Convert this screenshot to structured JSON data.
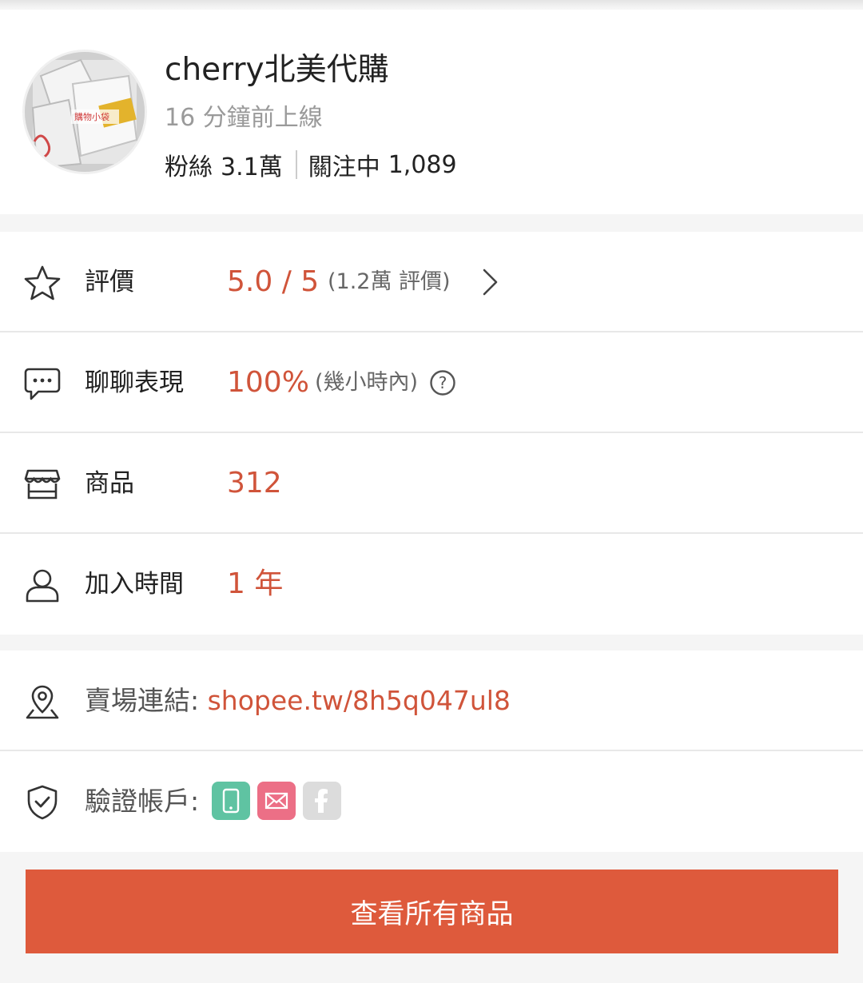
{
  "profile": {
    "shop_name": "cherry北美代購",
    "last_online": "16 分鐘前上線",
    "followers_label": "粉絲",
    "followers_value": "3.1萬",
    "following_label": "關注中",
    "following_value": "1,089",
    "avatar_text": "購物小袋"
  },
  "rows": {
    "rating": {
      "label": "評價",
      "value": "5.0 / 5",
      "note": "(1.2萬 評價)",
      "icon": "star-icon"
    },
    "chat": {
      "label": "聊聊表現",
      "value": "100%",
      "note": "(幾小時內)",
      "icon": "chat-bubble-icon"
    },
    "products": {
      "label": "商品",
      "value": "312",
      "icon": "shop-icon"
    },
    "joined": {
      "label": "加入時間",
      "value": "1 年",
      "icon": "user-icon"
    }
  },
  "shop_link": {
    "label": "賣場連結: ",
    "url": "shopee.tw/8h5q047ul8",
    "icon": "location-pin-icon"
  },
  "verification": {
    "label": "驗證帳戶:",
    "icon": "shield-check-icon",
    "badges": [
      "phone-icon",
      "mail-icon",
      "facebook-icon"
    ]
  },
  "actions": {
    "view_all": "查看所有商品"
  },
  "colors": {
    "accent": "#d0543a",
    "button": "#de5a3c",
    "phone_badge": "#5fc3a2",
    "mail_badge": "#ec6f86",
    "fb_badge": "#dcdcdc"
  }
}
